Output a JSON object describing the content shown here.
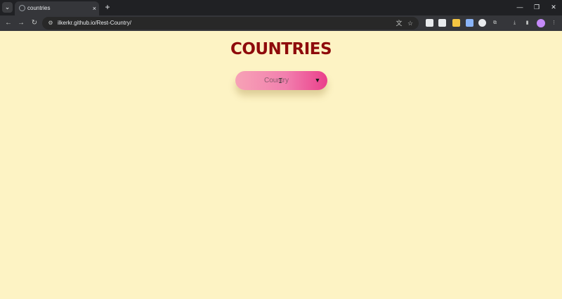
{
  "browser": {
    "tab": {
      "title": "countries",
      "close": "×"
    },
    "new_tab": "+",
    "tab_search": "⌄",
    "window": {
      "minimize": "—",
      "restore": "❐",
      "close": "✕"
    },
    "nav": {
      "back": "←",
      "forward": "→",
      "reload": "↻"
    },
    "url": "ilkerkr.github.io/Rest-Country/",
    "menu": "⋮"
  },
  "page": {
    "title": "COUNTRIES",
    "title_color": "#8e0b0b",
    "background": "#fdf3c4",
    "dropdown": {
      "label": "Country",
      "arrow": "▼"
    }
  }
}
